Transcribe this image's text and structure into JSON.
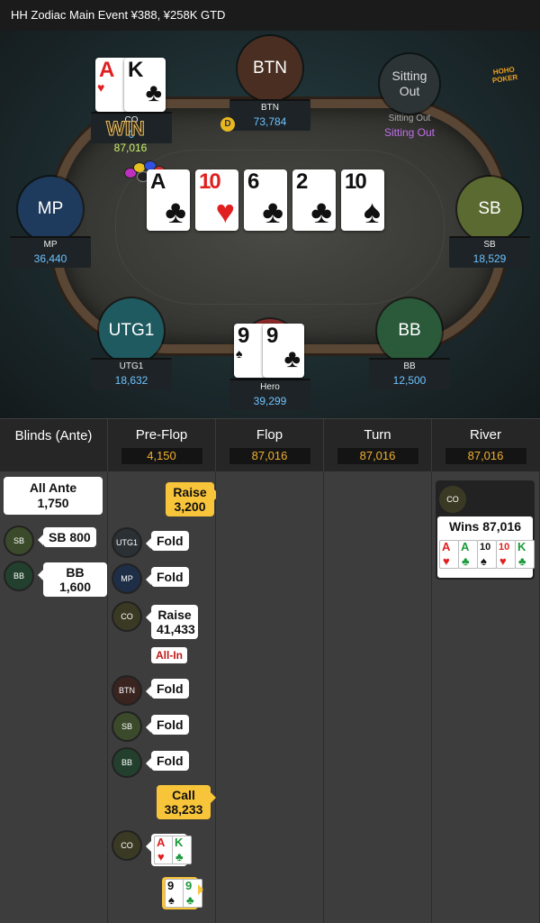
{
  "title": "HH  Zodiac Main Event ¥388, ¥258K GTD",
  "logo_text": [
    "HOHO",
    "POKER"
  ],
  "colors": {
    "accent_pot": "#f0b030",
    "stack_blue": "#6ec3ff",
    "raise_yellow": "#f8c43a",
    "allin_red": "#c01818",
    "sitting_out_purple": "#c070e8"
  },
  "seats": {
    "btn": {
      "avatar": "BTN",
      "name": "BTN",
      "stack": "73,784"
    },
    "sitout": {
      "avatar": "Sitting Out",
      "name": "Sitting Out",
      "stack": "Sitting Out"
    },
    "co": {
      "name": "CO",
      "stack": "0",
      "bet": "87,016",
      "cards": [
        {
          "rank": "A",
          "suit": "♥",
          "color": "red"
        },
        {
          "rank": "K",
          "suit": "♣",
          "color": "blk"
        }
      ],
      "win": "WIN"
    },
    "mp": {
      "avatar": "MP",
      "name": "MP",
      "stack": "36,440"
    },
    "sb": {
      "avatar": "SB",
      "name": "SB",
      "stack": "18,529"
    },
    "utg1": {
      "avatar": "UTG1",
      "name": "UTG1",
      "stack": "18,632"
    },
    "bb": {
      "avatar": "BB",
      "name": "BB",
      "stack": "12,500"
    },
    "hero": {
      "name": "Hero",
      "stack": "39,299",
      "cards": [
        {
          "rank": "9",
          "suit": "♠",
          "color": "blk"
        },
        {
          "rank": "9",
          "suit": "♣",
          "color": "blk"
        }
      ]
    }
  },
  "dealer_button": "D",
  "board": [
    {
      "rank": "A",
      "suit": "♣",
      "color": "blk"
    },
    {
      "rank": "10",
      "suit": "♥",
      "color": "red"
    },
    {
      "rank": "6",
      "suit": "♣",
      "color": "blk"
    },
    {
      "rank": "2",
      "suit": "♣",
      "color": "blk"
    },
    {
      "rank": "10",
      "suit": "♠",
      "color": "blk"
    }
  ],
  "streets": [
    {
      "name": "Blinds (Ante)",
      "pot": ""
    },
    {
      "name": "Pre-Flop",
      "pot": "4,150"
    },
    {
      "name": "Flop",
      "pot": "87,016"
    },
    {
      "name": "Turn",
      "pot": "87,016"
    },
    {
      "name": "River",
      "pot": "87,016"
    }
  ],
  "blinds": {
    "ante_line1": "All Ante",
    "ante_line2": "1,750",
    "sb_tag": "SB",
    "sb_text": "SB 800",
    "bb_tag": "BB",
    "bb_text": "BB 1,600"
  },
  "preflop": {
    "raise_label": "Raise",
    "raise_amount": "3,200",
    "actions": [
      {
        "tag": "UTG1",
        "text": "Fold"
      },
      {
        "tag": "MP",
        "text": "Fold"
      }
    ],
    "co_tag": "CO",
    "co_raise_label": "Raise",
    "co_raise_amount": "41,433",
    "allin": "All-In",
    "folds2": [
      {
        "tag": "BTN",
        "text": "Fold"
      },
      {
        "tag": "SB",
        "text": "Fold"
      },
      {
        "tag": "BB",
        "text": "Fold"
      }
    ],
    "call_label": "Call",
    "call_amount": "38,233",
    "show_tag": "CO",
    "co_show": [
      {
        "rank": "A",
        "suit": "♥",
        "color": "red"
      },
      {
        "rank": "K",
        "suit": "♣",
        "color": "grn"
      }
    ],
    "hero_show": [
      {
        "rank": "9",
        "suit": "♠",
        "color": "blk"
      },
      {
        "rank": "9",
        "suit": "♣",
        "color": "grn"
      }
    ]
  },
  "river": {
    "tag": "CO",
    "wins": "Wins 87,016",
    "cards": [
      {
        "rank": "A",
        "suit": "♥",
        "color": "red"
      },
      {
        "rank": "A",
        "suit": "♣",
        "color": "grn"
      },
      {
        "rank": "10",
        "suit": "♠",
        "color": "blk"
      },
      {
        "rank": "10",
        "suit": "♥",
        "color": "red"
      },
      {
        "rank": "K",
        "suit": "♣",
        "color": "grn"
      }
    ]
  }
}
